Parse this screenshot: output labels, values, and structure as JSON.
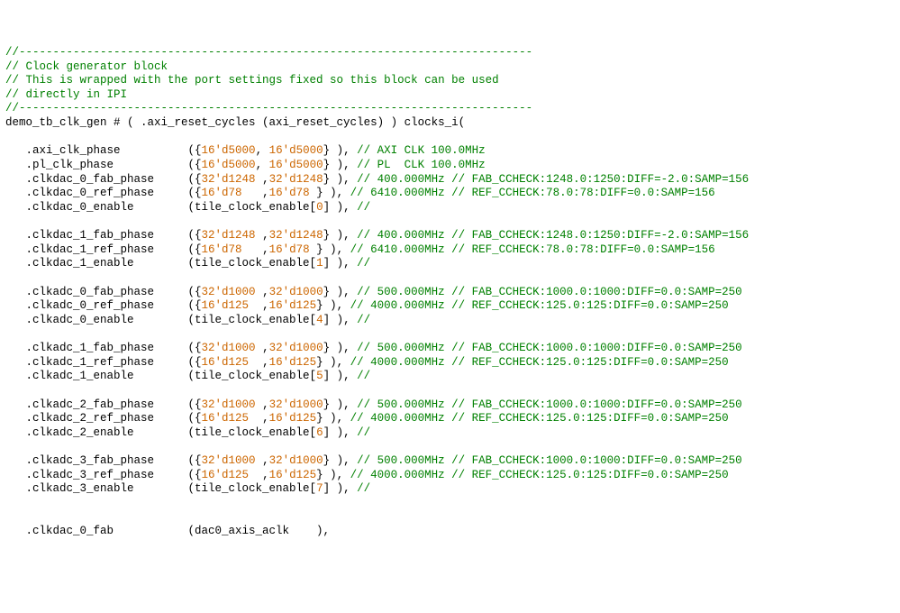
{
  "header": {
    "rule": "//----------------------------------------------------------------------------",
    "c1": "// Clock generator block",
    "c2": "// This is wrapped with the port settings fixed so this block can be used",
    "c3": "// directly in IPI"
  },
  "inst": {
    "module": "demo_tb_clk_gen",
    "param_name": "axi_reset_cycles",
    "param_expr": "axi_reset_cycles",
    "inst_name": "clocks_i"
  },
  "simple": [
    {
      "port": ".axi_clk_phase",
      "l1": "16'd5000",
      "l2": "16'd5000",
      "cmt": "// AXI CLK 100.0MHz"
    },
    {
      "port": ".pl_clk_phase",
      "l1": "16'd5000",
      "l2": "16'd5000",
      "cmt": "// PL  CLK 100.0MHz"
    }
  ],
  "groups": [
    {
      "fab": {
        "port": ".clkdac_0_fab_phase",
        "l1": "32'd1248",
        "l2": "32'd1248",
        "cmt": "// 400.000MHz // FAB_CCHECK:1248.0:1250:DIFF=-2.0:SAMP=156"
      },
      "ref": {
        "port": ".clkdac_0_ref_phase",
        "l1": "16'd78",
        "l2": "16'd78",
        "cmt": "// 6410.000MHz // REF_CCHECK:78.0:78:DIFF=0.0:SAMP=156"
      },
      "en": {
        "port": ".clkdac_0_enable",
        "arr": "tile_clock_enable",
        "idx": "0",
        "cmt": "//"
      }
    },
    {
      "fab": {
        "port": ".clkdac_1_fab_phase",
        "l1": "32'd1248",
        "l2": "32'd1248",
        "cmt": "// 400.000MHz // FAB_CCHECK:1248.0:1250:DIFF=-2.0:SAMP=156"
      },
      "ref": {
        "port": ".clkdac_1_ref_phase",
        "l1": "16'd78",
        "l2": "16'd78",
        "cmt": "// 6410.000MHz // REF_CCHECK:78.0:78:DIFF=0.0:SAMP=156"
      },
      "en": {
        "port": ".clkdac_1_enable",
        "arr": "tile_clock_enable",
        "idx": "1",
        "cmt": "//"
      }
    },
    {
      "fab": {
        "port": ".clkadc_0_fab_phase",
        "l1": "32'd1000",
        "l2": "32'd1000",
        "cmt": "// 500.000MHz // FAB_CCHECK:1000.0:1000:DIFF=0.0:SAMP=250"
      },
      "ref": {
        "port": ".clkadc_0_ref_phase",
        "l1": "16'd125",
        "l2": "16'd125",
        "cmt": "// 4000.000MHz // REF_CCHECK:125.0:125:DIFF=0.0:SAMP=250"
      },
      "en": {
        "port": ".clkadc_0_enable",
        "arr": "tile_clock_enable",
        "idx": "4",
        "cmt": "//"
      }
    },
    {
      "fab": {
        "port": ".clkadc_1_fab_phase",
        "l1": "32'd1000",
        "l2": "32'd1000",
        "cmt": "// 500.000MHz // FAB_CCHECK:1000.0:1000:DIFF=0.0:SAMP=250"
      },
      "ref": {
        "port": ".clkadc_1_ref_phase",
        "l1": "16'd125",
        "l2": "16'd125",
        "cmt": "// 4000.000MHz // REF_CCHECK:125.0:125:DIFF=0.0:SAMP=250"
      },
      "en": {
        "port": ".clkadc_1_enable",
        "arr": "tile_clock_enable",
        "idx": "5",
        "cmt": "//"
      }
    },
    {
      "fab": {
        "port": ".clkadc_2_fab_phase",
        "l1": "32'd1000",
        "l2": "32'd1000",
        "cmt": "// 500.000MHz // FAB_CCHECK:1000.0:1000:DIFF=0.0:SAMP=250"
      },
      "ref": {
        "port": ".clkadc_2_ref_phase",
        "l1": "16'd125",
        "l2": "16'd125",
        "cmt": "// 4000.000MHz // REF_CCHECK:125.0:125:DIFF=0.0:SAMP=250"
      },
      "en": {
        "port": ".clkadc_2_enable",
        "arr": "tile_clock_enable",
        "idx": "6",
        "cmt": "//"
      }
    },
    {
      "fab": {
        "port": ".clkadc_3_fab_phase",
        "l1": "32'd1000",
        "l2": "32'd1000",
        "cmt": "// 500.000MHz // FAB_CCHECK:1000.0:1000:DIFF=0.0:SAMP=250"
      },
      "ref": {
        "port": ".clkadc_3_ref_phase",
        "l1": "16'd125",
        "l2": "16'd125",
        "cmt": "// 4000.000MHz // REF_CCHECK:125.0:125:DIFF=0.0:SAMP=250"
      },
      "en": {
        "port": ".clkadc_3_enable",
        "arr": "tile_clock_enable",
        "idx": "7",
        "cmt": "//"
      }
    }
  ],
  "tail": {
    "port": ".clkdac_0_fab",
    "expr": "dac0_axis_aclk"
  }
}
